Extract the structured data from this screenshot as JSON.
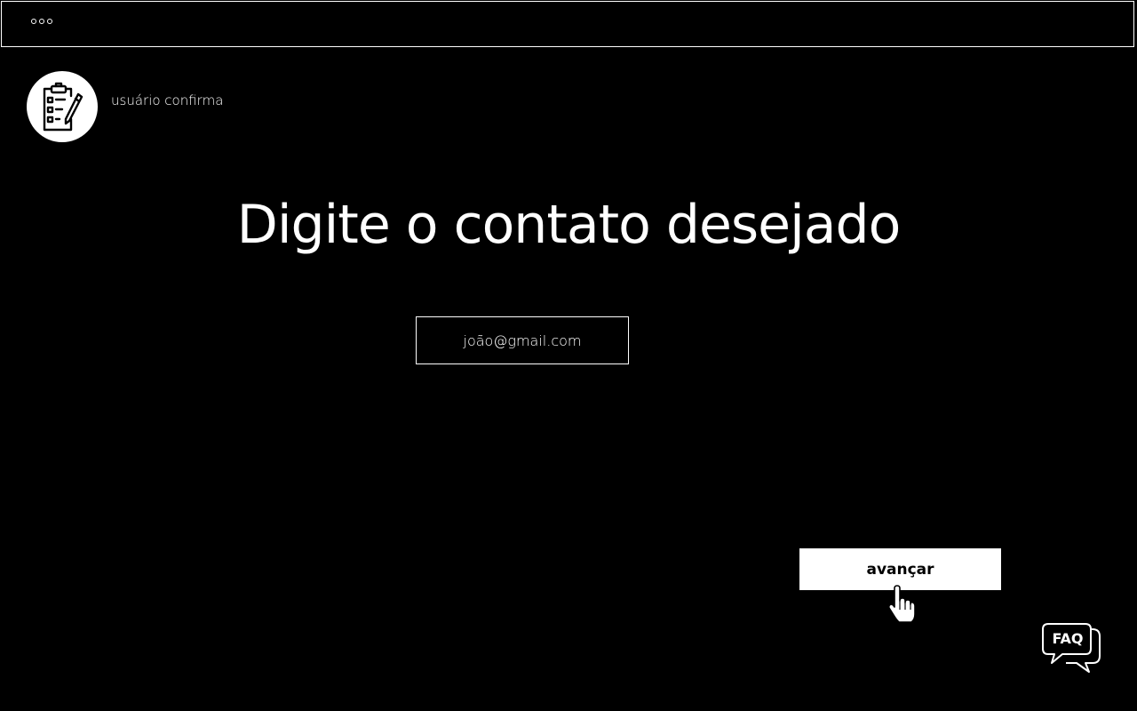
{
  "window": {
    "controls_icon": "window-dots-icon"
  },
  "step": {
    "icon": "clipboard-checklist-icon",
    "label": "usuário confirma"
  },
  "main": {
    "title": "Digite o contato desejado",
    "contact_input": {
      "value": "joão@gmail.com"
    },
    "next_button_label": "avançar"
  },
  "faq": {
    "label": "FAQ",
    "icon": "chat-bubbles-icon"
  },
  "colors": {
    "background": "#000000",
    "foreground": "#ffffff"
  }
}
